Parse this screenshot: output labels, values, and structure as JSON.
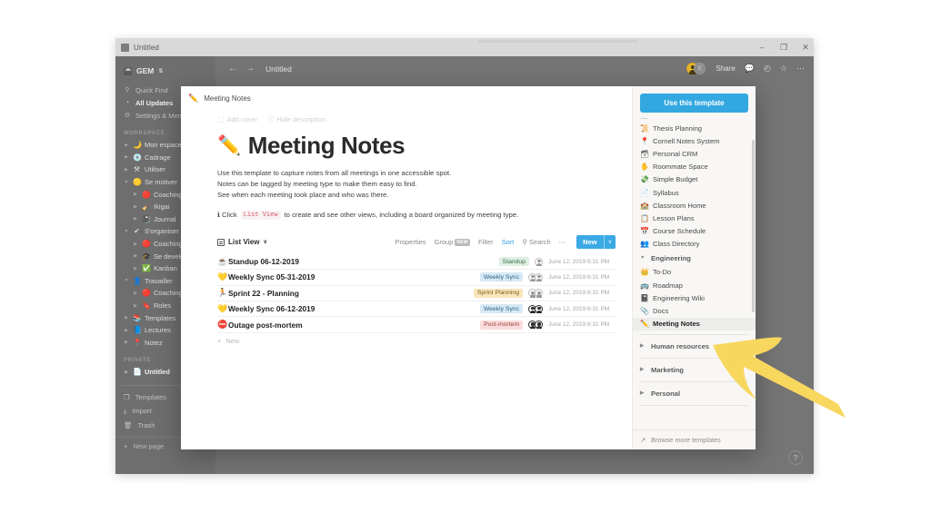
{
  "window": {
    "title": "Untitled",
    "app_icon": "app-icon",
    "minimize": "–",
    "maximize": "❐",
    "close": "✕"
  },
  "sidebar": {
    "workspace_name": "GEM",
    "workspace_caret": "⇅",
    "top_items": [
      {
        "icon": "⚲",
        "label": "Quick Find",
        "name": "quick-find"
      },
      {
        "icon": "◔",
        "label": "All Updates",
        "name": "all-updates"
      },
      {
        "icon": "⚙",
        "label": "Settings & Members",
        "name": "settings-members"
      }
    ],
    "section_workspace": "WORKSPACE",
    "workspace_items": [
      {
        "arrow": "▶",
        "emoji": "🌙",
        "label": "Mon espace",
        "indent": 0
      },
      {
        "arrow": "▶",
        "emoji": "💿",
        "label": "Cadrage",
        "indent": 0
      },
      {
        "arrow": "▶",
        "emoji": "⚒",
        "label": "Utiliser",
        "indent": 0
      },
      {
        "arrow": "▼",
        "emoji": "🟡",
        "label": "Se motiver",
        "indent": 0
      },
      {
        "arrow": "▶",
        "emoji": "🔴",
        "label": "Coaching",
        "indent": 1
      },
      {
        "arrow": "▶",
        "emoji": "🧹",
        "label": "Ikigai",
        "indent": 1
      },
      {
        "arrow": "▶",
        "emoji": "📓",
        "label": "Journal",
        "indent": 1
      },
      {
        "arrow": "▼",
        "emoji": "✔",
        "label": "S'organiser",
        "indent": 0
      },
      {
        "arrow": "▶",
        "emoji": "🔴",
        "label": "Coaching",
        "indent": 1
      },
      {
        "arrow": "▶",
        "emoji": "🎓",
        "label": "Se developper",
        "indent": 1
      },
      {
        "arrow": "▶",
        "emoji": "✅",
        "label": "Kanban",
        "indent": 1
      },
      {
        "arrow": "▼",
        "emoji": "👤",
        "label": "Travailler",
        "indent": 0
      },
      {
        "arrow": "▶",
        "emoji": "🔴",
        "label": "Coaching",
        "indent": 1
      },
      {
        "arrow": "▶",
        "emoji": "🔖",
        "label": "Roles",
        "indent": 1
      },
      {
        "arrow": "▶",
        "emoji": "📚",
        "label": "Templates",
        "indent": 0
      },
      {
        "arrow": "▶",
        "emoji": "📘",
        "label": "Lectures",
        "indent": 0
      },
      {
        "arrow": "▶",
        "emoji": "📍",
        "label": "Notez",
        "indent": 0
      }
    ],
    "section_private": "PRIVATE",
    "private_items": [
      {
        "arrow": "▶",
        "emoji": "📄",
        "label": "Untitled",
        "indent": 0
      }
    ],
    "footer_items": [
      {
        "icon": "❐",
        "label": "Templates",
        "name": "templates"
      },
      {
        "icon": "⤓",
        "label": "Import",
        "name": "import"
      },
      {
        "icon": "🗑",
        "label": "Trash",
        "name": "trash"
      }
    ],
    "new_page": {
      "icon": "+",
      "label": "New page"
    }
  },
  "topbar": {
    "back": "←",
    "forward": "→",
    "breadcrumb": "Untitled",
    "avatar_initial": "E",
    "share_label": "Share",
    "comment_icon": "💬",
    "history_icon": "◴",
    "favorite_icon": "☆",
    "more_icon": "⋯"
  },
  "help_button": "?",
  "modal": {
    "header": {
      "emoji": "✏️",
      "title": "Meeting Notes"
    },
    "doc_actions": [
      {
        "icon": "⬚",
        "label": "Add cover",
        "name": "add-cover"
      },
      {
        "icon": "ⓘ",
        "label": "Hide description",
        "name": "hide-description"
      }
    ],
    "title_emoji": "✏️",
    "title": "Meeting Notes",
    "description_lines": [
      "Use this template to capture notes from all meetings in one accessible spot.",
      "Notes can be tagged by meeting type to make them easy to find.",
      "See when each meeting took place and who was there."
    ],
    "callout": {
      "lead": "ℹ Click",
      "code": "List View",
      "tail": "to create and see other views, including a board organized by meeting type."
    },
    "view": {
      "name": "List View",
      "caret": "∨",
      "tools": [
        {
          "label": "Properties",
          "name": "properties"
        },
        {
          "label": "Group",
          "name": "group",
          "badge": "NEW"
        },
        {
          "label": "Filter",
          "name": "filter"
        },
        {
          "label": "Sort",
          "name": "sort",
          "active": true
        },
        {
          "label": "Search",
          "name": "search",
          "icon": "⚲"
        },
        {
          "label": "⋯",
          "name": "more-options"
        }
      ],
      "new_button": {
        "label": "New",
        "caret": "∨"
      }
    },
    "rows": [
      {
        "emoji": "☕",
        "title": "Standup 06-12-2019",
        "tag": "Standup",
        "tag_bg": "#dff0e3",
        "tag_fg": "#3a6b48",
        "faces": 1,
        "faces_dark": false,
        "date": "June 12, 2019 6:31 PM"
      },
      {
        "emoji": "💛",
        "title": "Weekly Sync 05-31-2019",
        "tag": "Weekly Sync",
        "tag_bg": "#d6e9f5",
        "tag_fg": "#2f6386",
        "faces": 2,
        "faces_dark": false,
        "date": "June 12, 2019 6:31 PM"
      },
      {
        "emoji": "🏃",
        "title": "Sprint 22 - Planning",
        "tag": "Sprint Planning",
        "tag_bg": "#fae6bd",
        "tag_fg": "#7a5a18",
        "faces": 2,
        "faces_dark": false,
        "date": "June 12, 2019 6:31 PM"
      },
      {
        "emoji": "💛",
        "title": "Weekly Sync 06-12-2019",
        "tag": "Weekly Sync",
        "tag_bg": "#d6e9f5",
        "tag_fg": "#2f6386",
        "faces": 2,
        "faces_dark": true,
        "date": "June 12, 2019 6:31 PM"
      },
      {
        "emoji": "⛔",
        "title": "Outage post-mortem",
        "tag": "Post-mortem",
        "tag_bg": "#fbdcdc",
        "tag_fg": "#9b3b3b",
        "faces": 2,
        "faces_dark": true,
        "date": "June 12, 2019 6:31 PM"
      }
    ],
    "new_row": {
      "icon": "+",
      "label": "New"
    }
  },
  "template_panel": {
    "use_button": "Use this template",
    "items_top": [
      {
        "emoji": "📜",
        "label": "Thesis Planning"
      },
      {
        "emoji": "📍",
        "label": "Cornell Notes System"
      },
      {
        "emoji": "🗃",
        "label": "Personal CRM"
      },
      {
        "emoji": "✋",
        "label": "Roommate Space"
      },
      {
        "emoji": "💸",
        "label": "Simple Budget"
      },
      {
        "emoji": "📄",
        "label": "Syllabus"
      },
      {
        "emoji": "🏫",
        "label": "Classroom Home"
      },
      {
        "emoji": "📋",
        "label": "Lesson Plans"
      },
      {
        "emoji": "📅",
        "label": "Course Schedule"
      },
      {
        "emoji": "👥",
        "label": "Class Directory"
      }
    ],
    "group_engineering": {
      "arrow": "▼",
      "label": "Engineering"
    },
    "engineering_items": [
      {
        "emoji": "👑",
        "label": "To-Do",
        "selected": false
      },
      {
        "emoji": "🚌",
        "label": "Roadmap",
        "selected": false
      },
      {
        "emoji": "📓",
        "label": "Engineering Wiki",
        "selected": false
      },
      {
        "emoji": "📎",
        "label": "Docs",
        "selected": false
      },
      {
        "emoji": "✏️",
        "label": "Meeting Notes",
        "selected": true
      }
    ],
    "collapsed_groups": [
      {
        "arrow": "▶",
        "label": "Human resources"
      },
      {
        "arrow": "▶",
        "label": "Marketing"
      },
      {
        "arrow": "▶",
        "label": "Personal"
      }
    ],
    "footer": {
      "icon": "↗",
      "label": "Browse more templates"
    }
  },
  "colors": {
    "accent_blue": "#33a8e0",
    "annotation_yellow": "#f8d75e",
    "panel_bg": "#f8f7f5",
    "window_chrome": "#6e6e6e"
  }
}
